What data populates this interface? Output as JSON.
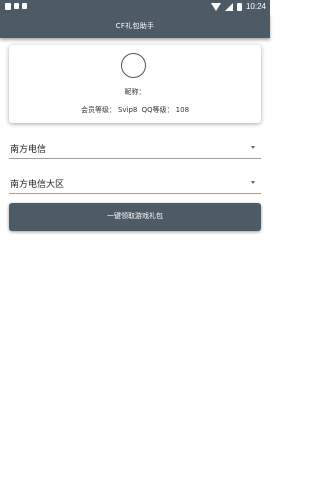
{
  "status_bar": {
    "time": "10:24",
    "left_icons": [
      "notification-icon-1",
      "image-icon",
      "notification-icon-2"
    ],
    "right_icons": [
      "wifi-icon",
      "signal-icon",
      "battery-icon"
    ]
  },
  "app_bar": {
    "title": "CF礼包助手"
  },
  "profile": {
    "nickname_label": "昵称：",
    "member_level_label": "会员等级：",
    "member_level_value": "Svip8",
    "qq_level_label": "QQ等级：",
    "qq_level_value": "108"
  },
  "spinners": {
    "region_selected": "南方电信",
    "server_selected": "南方电信大区"
  },
  "action_button": {
    "label": "一键领取游戏礼包"
  },
  "colors": {
    "primary": "#4d5b67",
    "background": "#ffffff"
  }
}
